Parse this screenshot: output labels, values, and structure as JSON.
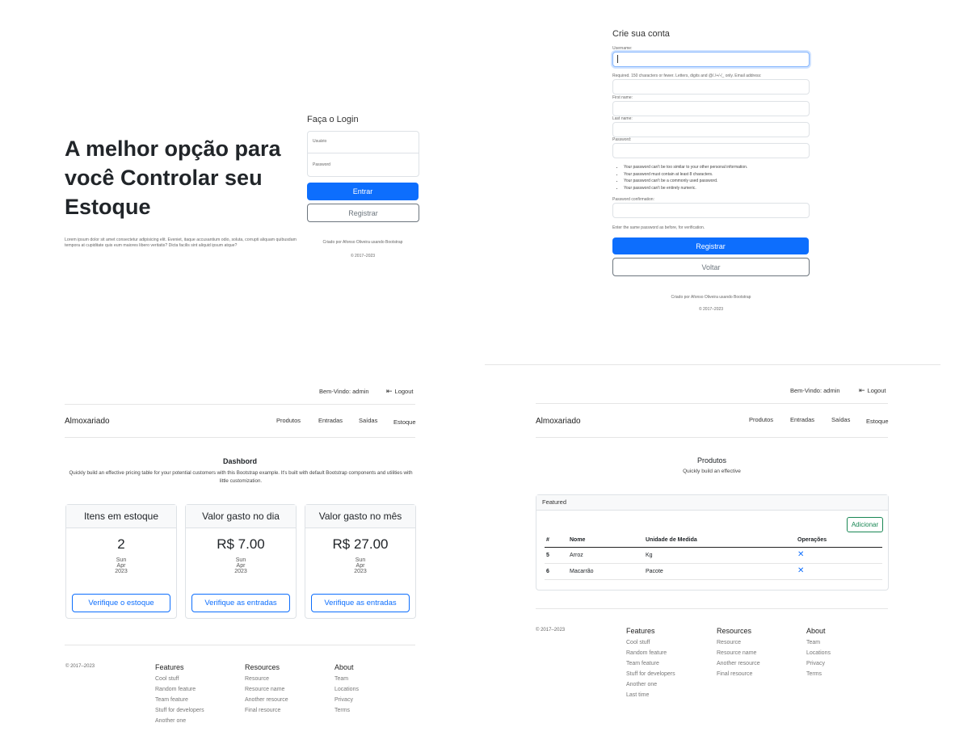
{
  "login": {
    "hero_title": "A melhor opção para você Controlar seu Estoque",
    "hero_text": "Lorem ipsum dolor sit amet consectetur adipisicing elit. Eveniet, itaque accusantium odio, soluta, corrupti aliquam quibusdam tempora at cupiditate quis eum maiores libero veritatis? Dicta facilis sint aliquid ipsum atque?",
    "form_title": "Faça o Login",
    "username_placeholder": "Usuário",
    "password_placeholder": "Password",
    "enter_label": "Entrar",
    "register_label": "Registrar",
    "credit": "Criado por Afonso Oliveira usando Bootstrap",
    "copyright": "© 2017–2023"
  },
  "signup": {
    "title": "Crie sua conta",
    "username_label": "Username:",
    "username_help": "Required. 150 characters or fewer. Letters, digits and @/./+/-/_ only. Email address:",
    "first_name_label": "First name:",
    "last_name_label": "Last name:",
    "password_label": "Password:",
    "password_rules": [
      "Your password can't be too similar to your other personal information.",
      "Your password must contain at least 8 characters.",
      "Your password can't be a commonly used password.",
      "Your password can't be entirely numeric."
    ],
    "confirm_label": "Password confirmation:",
    "confirm_help": "Enter the same password as before, for verification.",
    "register_label": "Registrar",
    "back_label": "Voltar",
    "credit": "Criado por Afonso Oliveira usando Bootstrap",
    "copyright": "© 2017–2023"
  },
  "dashboard": {
    "welcome": "Bem-Vindo: admin",
    "logout": "Logout",
    "brand": "Almoxariado",
    "nav": [
      "Produtos",
      "Entradas",
      "Saídas",
      "Estoque"
    ],
    "title": "Dashbord",
    "lead": "Quickly build an effective pricing table for your potential customers with this Bootstrap example. It's built with default Bootstrap components and utilities with little customization.",
    "cards": [
      {
        "header": "Itens em estoque",
        "value": "2",
        "day": "Sun",
        "month": "Apr",
        "year": "2023",
        "button": "Verifique o estoque"
      },
      {
        "header": "Valor gasto no dia",
        "value": "R$ 7.00",
        "day": "Sun",
        "month": "Apr",
        "year": "2023",
        "button": "Verifique as entradas"
      },
      {
        "header": "Valor gasto no mês",
        "value": "R$ 27.00",
        "day": "Sun",
        "month": "Apr",
        "year": "2023",
        "button": "Verifique as entradas"
      }
    ],
    "footer": {
      "copyright": "© 2017–2023",
      "columns": [
        {
          "title": "Features",
          "links": [
            "Cool stuff",
            "Random feature",
            "Team feature",
            "Stuff for developers",
            "Another one"
          ]
        },
        {
          "title": "Resources",
          "links": [
            "Resource",
            "Resource name",
            "Another resource",
            "Final resource"
          ]
        },
        {
          "title": "About",
          "links": [
            "Team",
            "Locations",
            "Privacy",
            "Terms"
          ]
        }
      ]
    }
  },
  "produtos": {
    "welcome": "Bem-Vindo: admin",
    "logout": "Logout",
    "brand": "Almoxariado",
    "nav": [
      "Produtos",
      "Entradas",
      "Saídas",
      "Estoque"
    ],
    "title": "Produtos",
    "lead": "Quickly build an effective",
    "card_header": "Featured",
    "add_label": "Adicionar",
    "table_headers": [
      "#",
      "Nome",
      "Unidade de Medida",
      "Operações"
    ],
    "rows": [
      {
        "id": "5",
        "name": "Arroz",
        "unit": "Kg"
      },
      {
        "id": "6",
        "name": "Macarrão",
        "unit": "Pacote"
      }
    ],
    "footer": {
      "copyright": "© 2017–2023",
      "columns": [
        {
          "title": "Features",
          "links": [
            "Cool stuff",
            "Random feature",
            "Team feature",
            "Stuff for developers",
            "Another one",
            "Last time"
          ]
        },
        {
          "title": "Resources",
          "links": [
            "Resource",
            "Resource name",
            "Another resource",
            "Final resource"
          ]
        },
        {
          "title": "About",
          "links": [
            "Team",
            "Locations",
            "Privacy",
            "Terms"
          ]
        }
      ]
    }
  },
  "colors": {
    "primary": "#0d6efd",
    "secondary": "#6c757d",
    "success": "#198754"
  }
}
